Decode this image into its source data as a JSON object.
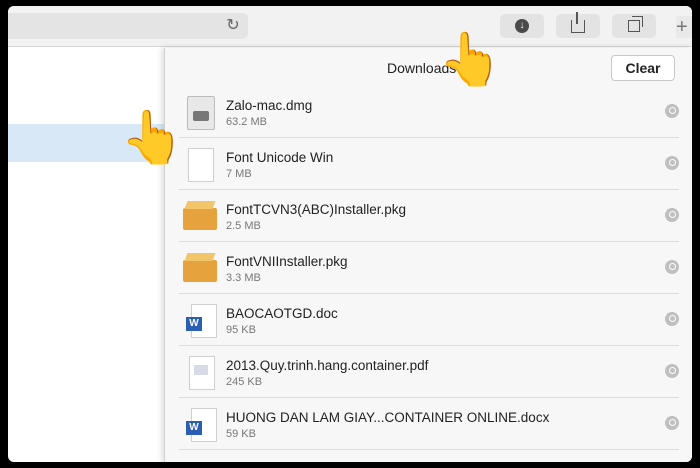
{
  "browser": {
    "reload_icon": "reload-icon",
    "toolbar_buttons": [
      "downloads-button",
      "share-button",
      "tabs-button"
    ],
    "plus_label": "+"
  },
  "downloads": {
    "title": "Downloads",
    "clear_label": "Clear",
    "items": [
      {
        "name": "Zalo-mac.dmg",
        "size": "63.2 MB",
        "icon": "disk-image-icon"
      },
      {
        "name": "Font Unicode Win",
        "size": "7 MB",
        "icon": "document-icon"
      },
      {
        "name": "FontTCVN3(ABC)Installer.pkg",
        "size": "2.5 MB",
        "icon": "package-icon"
      },
      {
        "name": "FontVNIInstaller.pkg",
        "size": "3.3 MB",
        "icon": "package-icon"
      },
      {
        "name": "BAOCAOTGD.doc",
        "size": "95 KB",
        "icon": "word-doc-icon"
      },
      {
        "name": "2013.Quy.trinh.hang.container.pdf",
        "size": "245 KB",
        "icon": "pdf-icon"
      },
      {
        "name": "HUONG DAN LAM GIAY...CONTAINER ONLINE.docx",
        "size": "59 KB",
        "icon": "word-doc-icon"
      }
    ]
  }
}
